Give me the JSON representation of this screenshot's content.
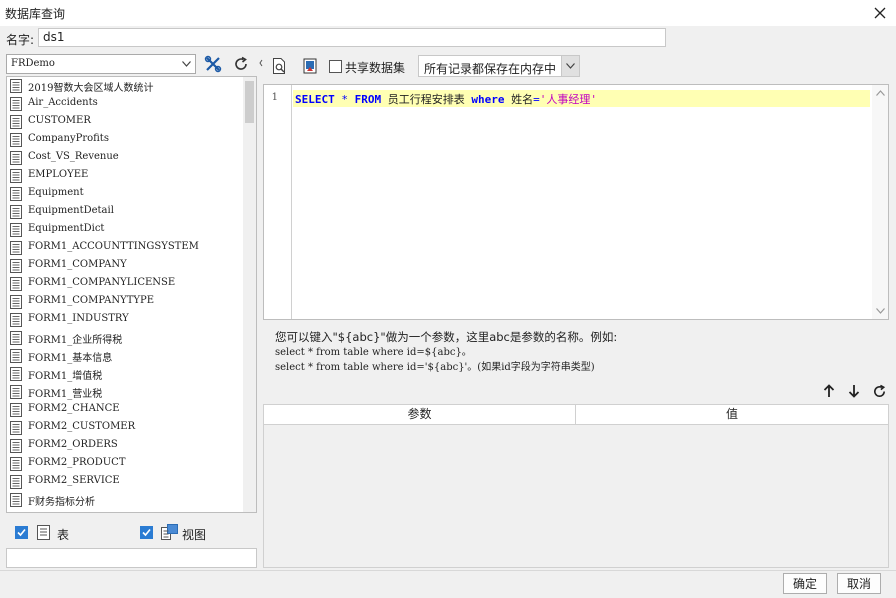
{
  "window": {
    "title": "数据库查询"
  },
  "name_field": {
    "label": "名字:",
    "value": "ds1"
  },
  "datasource": {
    "selected": "FRDemo"
  },
  "tables": [
    "2019智数大会区域人数统计",
    "Air_Accidents",
    "CUSTOMER",
    "CompanyProfits",
    "Cost_VS_Revenue",
    "EMPLOYEE",
    "Equipment",
    "EquipmentDetail",
    "EquipmentDict",
    "FORM1_ACCOUNTTINGSYSTEM",
    "FORM1_COMPANY",
    "FORM1_COMPANYLICENSE",
    "FORM1_COMPANYTYPE",
    "FORM1_INDUSTRY",
    "FORM1_企业所得税",
    "FORM1_基本信息",
    "FORM1_增值税",
    "FORM1_营业税",
    "FORM2_CHANCE",
    "FORM2_CUSTOMER",
    "FORM2_ORDERS",
    "FORM2_PRODUCT",
    "FORM2_SERVICE",
    "F财务指标分析"
  ],
  "filters": {
    "table_label": "表",
    "view_label": "视图",
    "table_checked": true,
    "view_checked": true
  },
  "query_toolbar": {
    "share_label": "共享数据集",
    "mode_selected": "所有记录都保存在内存中"
  },
  "editor": {
    "line_number": "1",
    "tokens": {
      "select": "SELECT",
      "star": "*",
      "from": "FROM",
      "table": "员工行程安排表",
      "where": "where",
      "field": "姓名",
      "eq": "=",
      "value": "'人事经理'"
    }
  },
  "hint": {
    "line1": "您可以键入\"${abc}\"做为一个参数，这里abc是参数的名称。例如:",
    "line2": "select * from table where id=${abc}。",
    "line3": "select * from table where id='${abc}'。(如果id字段为字符串类型)"
  },
  "params_table": {
    "col_param": "参数",
    "col_value": "值"
  },
  "buttons": {
    "ok": "确定",
    "cancel": "取消"
  },
  "colors": {
    "accent": "#2b7cd3",
    "keyword": "#0000ff",
    "string": "#c000c0",
    "line_highlight": "#ffffb3"
  }
}
